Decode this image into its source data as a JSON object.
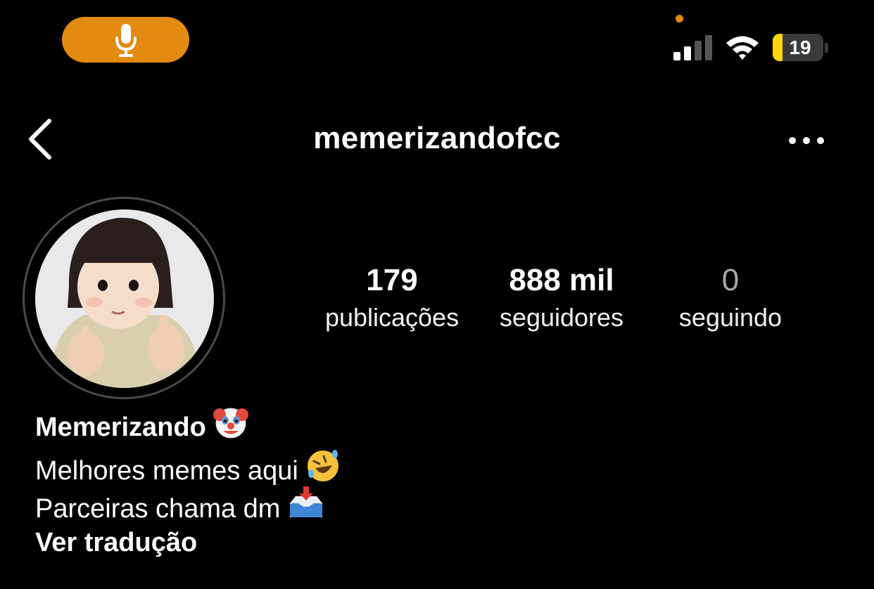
{
  "status_bar": {
    "battery_level": "19",
    "battery_fraction": 0.19,
    "accent_color": "#e38a10"
  },
  "header": {
    "username": "memerizandofcc",
    "back_icon": "chevron-left-icon",
    "more_icon": "ellipsis-icon"
  },
  "profile": {
    "stats": [
      {
        "value": "179",
        "label": "publicações"
      },
      {
        "value": "888 mil",
        "label": "seguidores"
      },
      {
        "value": "0",
        "label": "seguindo"
      }
    ],
    "display_name": "Memerizando",
    "display_name_emoji": "clown-face-icon",
    "bio_lines": [
      {
        "text": "Melhores memes aqui",
        "emoji": "rolling-on-floor-laughing-icon"
      },
      {
        "text": "Parceiras chama dm",
        "emoji": "inbox-tray-icon"
      }
    ],
    "translate_link": "Ver tradução"
  }
}
